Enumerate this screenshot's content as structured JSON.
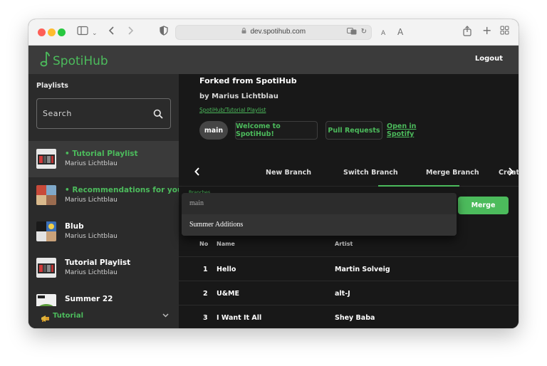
{
  "browser": {
    "url": "dev.spotihub.com",
    "text_size_small": "A",
    "text_size_large": "A"
  },
  "header": {
    "logo_text": "SpotiHub",
    "logout_label": "Logout"
  },
  "sidebar": {
    "title": "Playlists",
    "search_placeholder": "Search",
    "playlists": [
      {
        "name": "• Tutorial Playlist",
        "owner": "Marius Lichtblau",
        "active": true,
        "highlight": true
      },
      {
        "name": "• Recommendations for you",
        "owner": "Marius Lichtblau",
        "active": false,
        "highlight": true
      },
      {
        "name": "Blub",
        "owner": "Marius Lichtblau",
        "active": false,
        "highlight": false
      },
      {
        "name": "Tutorial Playlist",
        "owner": "Marius Lichtblau",
        "active": false,
        "highlight": false
      },
      {
        "name": "Summer 22",
        "owner": "",
        "active": false,
        "highlight": false
      }
    ],
    "footer_label": "Tutorial"
  },
  "main": {
    "title": "Forked from SpotiHub",
    "by": "by Marius Lichtblau",
    "source_link": "SpotiHub/Tutorial Playlist",
    "branch_badge": "main",
    "actions": {
      "welcome": "Welcome to SpotiHub!",
      "pull_requests": "Pull Requests",
      "open_spotify": "Open in Spotify"
    },
    "tabs": [
      "New Branch",
      "Switch Branch",
      "Merge Branch",
      "Create"
    ],
    "active_tab": "Merge Branch",
    "branches_label": "Branches",
    "merge_label": "Merge",
    "dropdown_options": [
      "main",
      "Summer Additions"
    ],
    "table": {
      "headers": {
        "no": "No",
        "name": "Name",
        "artist": "Artist"
      },
      "rows": [
        {
          "no": "1",
          "name": "Hello",
          "artist": "Martin Solveig"
        },
        {
          "no": "2",
          "name": "U&ME",
          "artist": "alt-J"
        },
        {
          "no": "3",
          "name": "I Want It All",
          "artist": "Shey Baba"
        }
      ]
    }
  },
  "colors": {
    "accent": "#4cbb5c",
    "header_bg": "#3b3b3b",
    "sidebar_bg": "#2b2b2b",
    "main_bg": "#181818"
  }
}
